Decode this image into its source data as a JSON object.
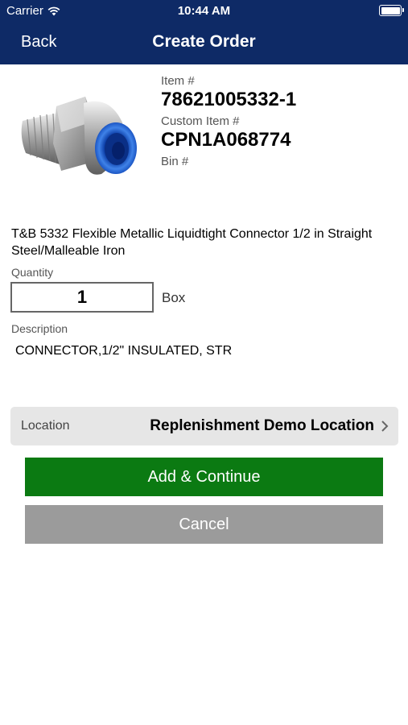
{
  "status_bar": {
    "carrier": "Carrier",
    "time": "10:44 AM"
  },
  "nav": {
    "back_label": "Back",
    "title": "Create Order"
  },
  "item": {
    "item_label": "Item #",
    "item_number": "78621005332-1",
    "custom_item_label": "Custom Item #",
    "custom_item_number": "CPN1A068774",
    "bin_label": "Bin #",
    "bin_value": "",
    "name": "T&B 5332 Flexible Metallic Liquidtight Connector 1/2 in Straight Steel/Malleable Iron"
  },
  "quantity": {
    "label": "Quantity",
    "value": "1",
    "unit": "Box"
  },
  "description": {
    "label": "Description",
    "value": "CONNECTOR,1/2\" INSULATED, STR"
  },
  "location": {
    "label": "Location",
    "value": "Replenishment Demo Location"
  },
  "buttons": {
    "add_continue": "Add & Continue",
    "cancel": "Cancel"
  },
  "colors": {
    "nav_background": "#0e2a66",
    "add_button": "#0b7a12",
    "cancel_button": "#9b9b9b",
    "location_row": "#e6e6e6"
  },
  "icons": {
    "wifi": "wifi-icon",
    "battery": "battery-icon",
    "chevron": "chevron-right-icon"
  }
}
